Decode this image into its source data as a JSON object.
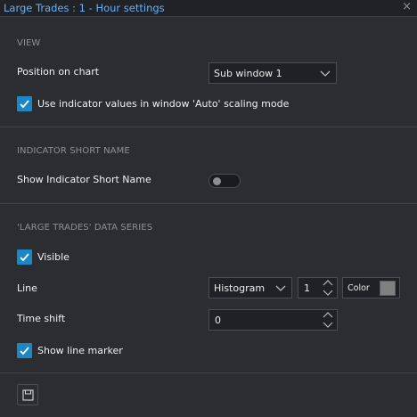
{
  "window": {
    "title": "Large Trades : 1 - Hour settings",
    "close_icon": "close-icon"
  },
  "view": {
    "header": "VIEW",
    "position_label": "Position on chart",
    "position_value": "Sub window 1",
    "auto_scaling_label": "Use indicator values in window 'Auto' scaling mode",
    "auto_scaling_checked": true
  },
  "short_name": {
    "header": "INDICATOR SHORT NAME",
    "show_label": "Show Indicator Short Name",
    "show_enabled": false
  },
  "series": {
    "header": "'LARGE TRADES' DATA SERIES",
    "visible_label": "Visible",
    "visible_checked": true,
    "line_label": "Line",
    "line_type": "Histogram",
    "line_width": "1",
    "color_label": "Color",
    "color_value": "#808080",
    "time_shift_label": "Time shift",
    "time_shift_value": "0",
    "marker_label": "Show line marker",
    "marker_checked": true
  },
  "footer": {
    "save_icon": "save-icon"
  },
  "colors": {
    "accent": "#1b87c4",
    "title": "#62b2ff",
    "background": "#2b2d30"
  }
}
